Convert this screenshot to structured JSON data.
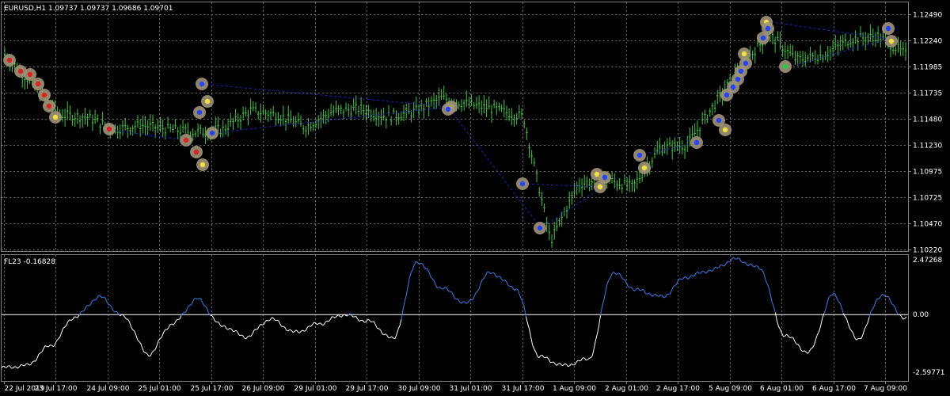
{
  "main_panel": {
    "header": "EURUSD,H1  1.09737 1.09737 1.09686 1.09701",
    "price_levels": [
      "1.12490",
      "1.12240",
      "1.11985",
      "1.11735",
      "1.11480",
      "1.11230",
      "1.10975",
      "1.10725",
      "1.10470",
      "1.10220"
    ],
    "series_color": "#3cc83c"
  },
  "indicator_panel": {
    "header": "FL23 -0.16828",
    "levels": [
      "2.47268",
      "0.00",
      "-2.59771"
    ],
    "colors": {
      "above_zero": "#3a7ff0",
      "below_zero": "#ffffff",
      "zero_line": "#ffffff"
    }
  },
  "time_labels": [
    "22 Jul 2019",
    "23 Jul 17:00",
    "24 Jul 09:00",
    "25 Jul 01:00",
    "25 Jul 17:00",
    "26 Jul 09:00",
    "29 Jul 01:00",
    "29 Jul 17:00",
    "30 Jul 09:00",
    "31 Jul 01:00",
    "31 Jul 17:00",
    "1 Aug 09:00",
    "2 Aug 01:00",
    "2 Aug 17:00",
    "5 Aug 09:00",
    "6 Aug 01:00",
    "6 Aug 17:00",
    "7 Aug 09:00"
  ],
  "chart_data": [
    {
      "type": "line",
      "series": [
        {
          "name": "EURUSD,H1",
          "x_anchor_labels": [
            "22 Jul 2019",
            "23 Jul 17:00",
            "24 Jul 09:00",
            "25 Jul 01:00",
            "25 Jul 17:00",
            "26 Jul 09:00",
            "29 Jul 01:00",
            "29 Jul 17:00",
            "30 Jul 09:00",
            "31 Jul 01:00",
            "31 Jul 17:00",
            "1 Aug 09:00",
            "2 Aug 01:00",
            "2 Aug 17:00",
            "5 Aug 09:00",
            "6 Aug 01:00",
            "6 Aug 17:00",
            "7 Aug 09:00"
          ],
          "values": [
            1.121,
            1.1182,
            1.1152,
            1.115,
            1.1138,
            1.1142,
            1.1138,
            1.1135,
            1.1138,
            1.1156,
            1.1152,
            1.114,
            1.1155,
            1.1158,
            1.115,
            1.1155,
            1.1168,
            1.1162,
            1.1157,
            1.115,
            1.103,
            1.1085,
            1.109,
            1.1082,
            1.112,
            1.1123,
            1.1162,
            1.12,
            1.123,
            1.1205,
            1.121,
            1.1225,
            1.1228,
            1.121
          ]
        }
      ],
      "ylim": [
        1.1022,
        1.1249
      ]
    },
    {
      "type": "line",
      "series": [
        {
          "name": "FL23",
          "values": [
            -2.4,
            -2.3,
            -1.4,
            -0.1,
            0.8,
            -0.1,
            -1.8,
            -0.4,
            0.7,
            -0.5,
            -1.0,
            -0.2,
            -0.8,
            -0.4,
            0.0,
            -0.3,
            -1.1,
            2.4,
            1.2,
            0.5,
            1.9,
            1.2,
            -1.9,
            -2.3,
            -2.0,
            1.9,
            1.1,
            0.8,
            1.7,
            2.0,
            2.5,
            2.1,
            -0.9,
            -1.7,
            0.9,
            -1.1,
            0.9,
            -0.2
          ]
        }
      ],
      "ylim": [
        -2.59771,
        2.47268
      ]
    }
  ]
}
